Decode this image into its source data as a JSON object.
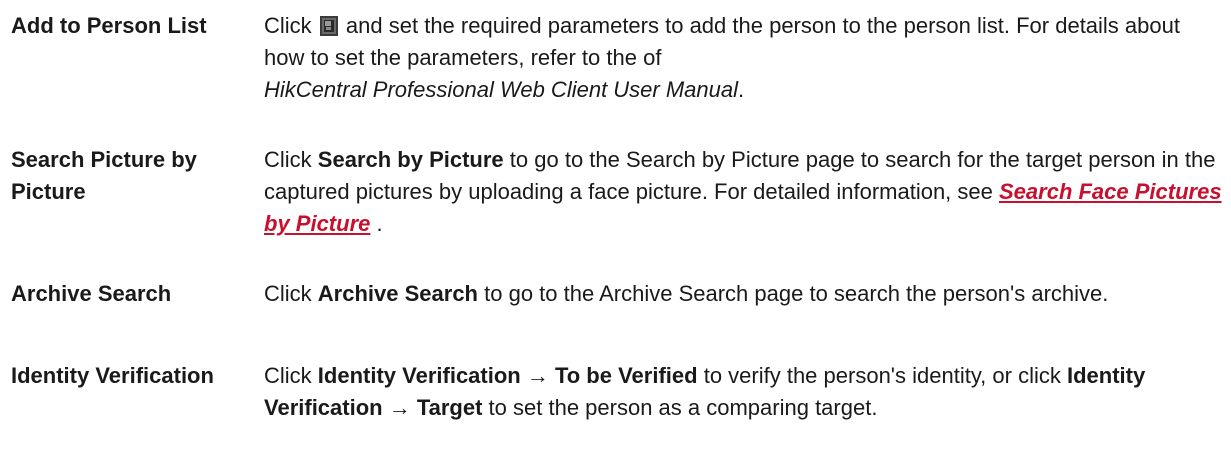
{
  "rows": [
    {
      "term": "Add to Person List",
      "desc": {
        "pre": "Click",
        "icon": "add-to-list-icon",
        "mid": "and set the required parameters to add the person to the person list. For details about how to set the parameters, refer to the of",
        "manual": "HikCentral Professional Web Client User Manual",
        "post": "."
      }
    },
    {
      "term": "Search Picture by Picture",
      "desc": {
        "pre": "Click",
        "bold": "Search by Picture",
        "mid": "to go to the Search by Picture page to search for the target person in the captured pictures by uploading a face picture. For detailed information, see",
        "link": "Search Face Pictures by Picture",
        "post": "."
      }
    },
    {
      "term": "Archive Search",
      "desc": {
        "pre": "Click",
        "bold": "Archive Search",
        "mid": "to go to the Archive Search page to search the person's archive."
      }
    },
    {
      "term": "Identity Verification",
      "desc": {
        "pre": "Click",
        "bold1": "Identity Verification → To be Verified",
        "mid1": "to verify the person's identity, or click",
        "bold2": "Identity Verification → Target",
        "mid2": "to set the person as a comparing target."
      }
    }
  ]
}
